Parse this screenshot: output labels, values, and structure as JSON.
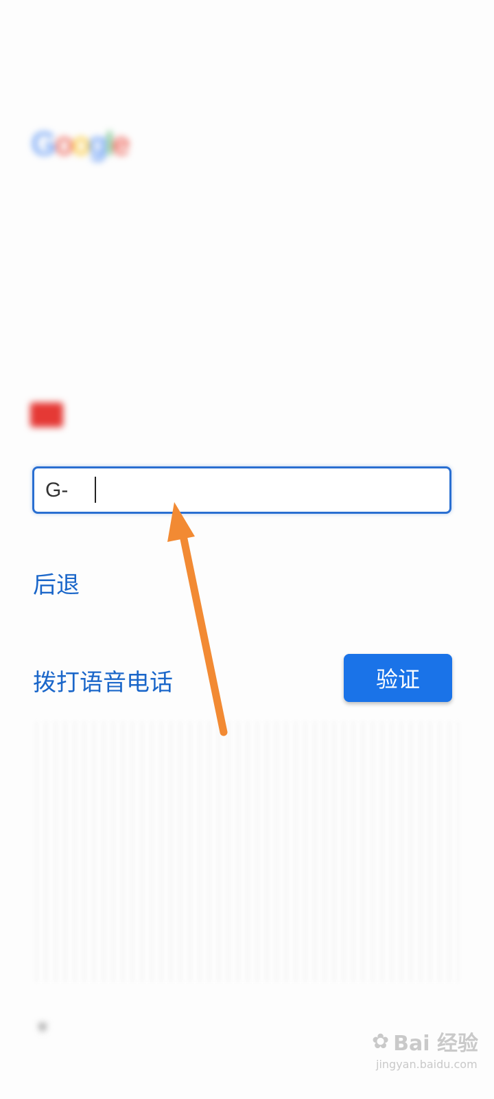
{
  "status_bar": {
    "left_text": "",
    "right_text": ""
  },
  "appbar": {
    "cancel_label": "",
    "title": ""
  },
  "logo": {
    "g1": "G",
    "o1": "o",
    "o2": "o",
    "g2": "g",
    "l": "l",
    "e": "e"
  },
  "heading": "",
  "description": "",
  "phone": {
    "number": "",
    "sub_label": ""
  },
  "code_input": {
    "prefix": "G-",
    "value": "",
    "placeholder": ""
  },
  "actions": {
    "back_label": "后退",
    "voice_call_label": "拨打语音电话",
    "verify_label": "验证"
  },
  "footer": {
    "language": "",
    "links": [
      "",
      "",
      ""
    ]
  },
  "watermark": {
    "brand": "Bai 经验",
    "url": "jingyan.baidu.com"
  },
  "colors": {
    "accent": "#1a73e8",
    "link": "#1a66c9",
    "arrow": "#f28a33",
    "input_border": "#2a6fd1"
  },
  "icons": {
    "arrow": "up-arrow-annotation",
    "flag": "flag-icon",
    "dropdown": "chevron-down-icon",
    "paw": "paw-icon"
  }
}
